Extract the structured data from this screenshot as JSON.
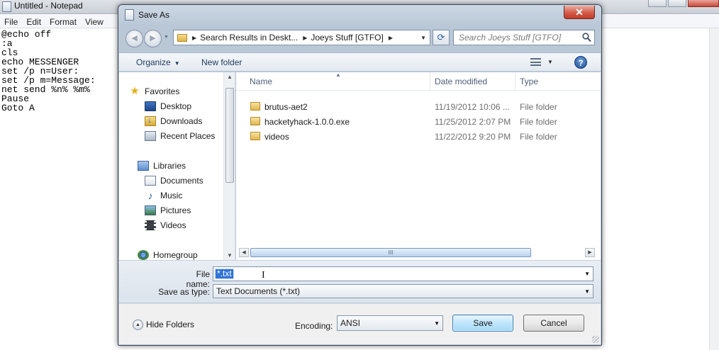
{
  "notepad": {
    "title": "Untitled - Notepad",
    "menu": [
      "File",
      "Edit",
      "Format",
      "View"
    ],
    "text": "@echo off\n:a\ncls\necho MESSENGER\nset /p n=User:\nset /p m=Message:\nnet send %n% %m%\nPause\nGoto A"
  },
  "dialog": {
    "title": "Save As",
    "close_label": "✕",
    "nav": {
      "back_glyph": "◀",
      "forward_glyph": "▶",
      "breadcrumbs": [
        "Search Results in Deskt...",
        "Joeys Stuff [GTFO]"
      ],
      "search_placeholder": "Search Joeys Stuff [GTFO]"
    },
    "toolbar": {
      "organize_label": "Organize",
      "new_folder_label": "New folder",
      "help_label": "?"
    },
    "nav_pane": {
      "favorites_label": "Favorites",
      "favorites": [
        "Desktop",
        "Downloads",
        "Recent Places"
      ],
      "libraries_label": "Libraries",
      "libraries": [
        "Documents",
        "Music",
        "Pictures",
        "Videos"
      ],
      "homegroup_label": "Homegroup"
    },
    "file_list": {
      "columns": [
        "Name",
        "Date modified",
        "Type"
      ],
      "rows": [
        {
          "name": "brutus-aet2",
          "date": "11/19/2012 10:06 ...",
          "type": "File folder"
        },
        {
          "name": "hacketyhack-1.0.0.exe",
          "date": "11/25/2012 2:07 PM",
          "type": "File folder"
        },
        {
          "name": "videos",
          "date": "11/22/2012 9:20 PM",
          "type": "File folder"
        }
      ],
      "scroll_grip": "III"
    },
    "file_name_label": "File name:",
    "file_name_value": "*.txt",
    "save_as_type_label": "Save as type:",
    "save_as_type_value": "Text Documents (*.txt)",
    "hide_folders_label": "Hide Folders",
    "encoding_label": "Encoding:",
    "encoding_value": "ANSI",
    "save_label": "Save",
    "cancel_label": "Cancel"
  },
  "colors": {
    "selection": "#3173d6",
    "save_button": "#bee6fd",
    "close_button": "#d45c49"
  }
}
